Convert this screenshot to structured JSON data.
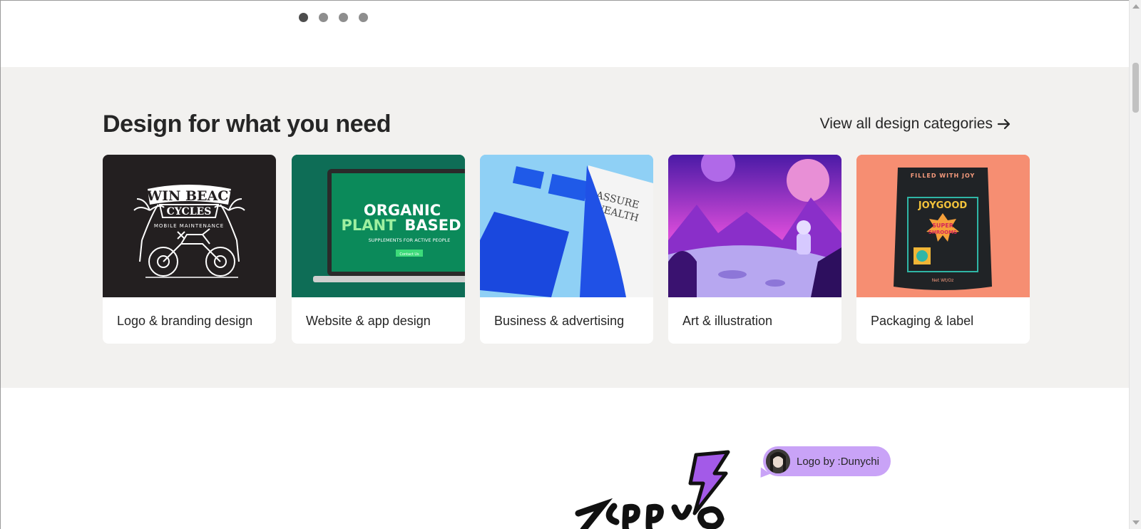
{
  "carousel": {
    "dot_count": 4,
    "active_index": 0
  },
  "section": {
    "heading": "Design for what you need",
    "view_all": "View all design categories"
  },
  "categories": [
    {
      "label": "Logo & branding design",
      "image_text": [
        "TWIN BEACH",
        "CYCLES",
        "MOBILE MAINTENANCE"
      ]
    },
    {
      "label": "Website & app design",
      "image_text": [
        "ORGANIC",
        "PLANT",
        "BASED",
        "SUPPLEMENTS FOR ACTIVE PEOPLE",
        "Contact Us"
      ]
    },
    {
      "label": "Business & advertising",
      "image_text": [
        "ASSURE",
        "WEALTH"
      ]
    },
    {
      "label": "Art & illustration",
      "image_text": []
    },
    {
      "label": "Packaging & label",
      "image_text": [
        "FILLED WITH JOY",
        "JOYGOOD",
        "SUPER",
        "SHROOMS",
        "Net Wt/Oz"
      ]
    }
  ],
  "credit": {
    "text": "Logo by :Dunychi"
  },
  "colors": {
    "band": "#f2f1ef",
    "credit_bubble": "#c9a3f7",
    "heading": "#262626"
  }
}
